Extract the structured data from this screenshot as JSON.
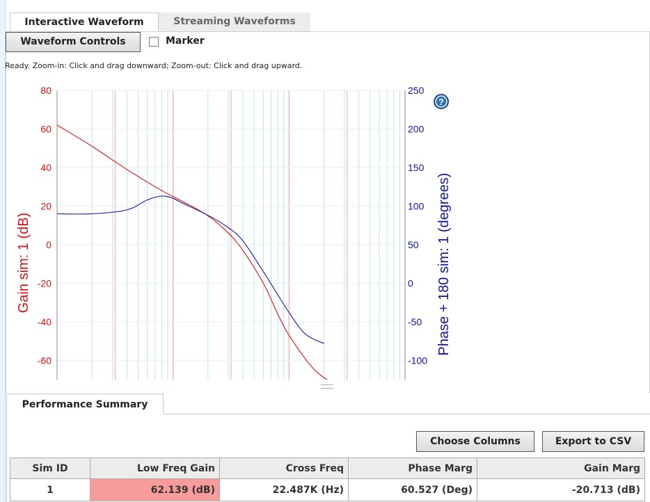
{
  "tabs": {
    "interactive": "Interactive Waveform",
    "streaming": "Streaming Waveforms"
  },
  "controls": {
    "waveform_button": "Waveform Controls",
    "marker_label": "Marker"
  },
  "status": "Ready.  Zoom-in: Click and drag downward; Zoom-out: Click and drag upward.",
  "colors": {
    "gain": "#dd1111",
    "phase": "#1111aa",
    "highlight": "#f79b9b"
  },
  "chart_data": {
    "type": "line",
    "x_scale": "log",
    "xlim": [
      1000,
      1000000
    ],
    "ylabel_left": "Gain sim:  1 (dB)",
    "ylabel_right": "Phase + 180 sim:  1 (degrees)",
    "ylim_left": [
      -70,
      80
    ],
    "ylim_right": [
      -125,
      250
    ],
    "yticks_left": [
      "80",
      "60",
      "40",
      "20",
      "0",
      "-20",
      "-40",
      "-60"
    ],
    "yticks_right": [
      "250",
      "200",
      "150",
      "100",
      "50",
      "0",
      "-50",
      "-100"
    ],
    "grid": true,
    "series": [
      {
        "name": "Gain",
        "axis": "left",
        "color": "#dd1111",
        "x": [
          1000,
          2000,
          4000,
          8000,
          12000,
          20000,
          30000,
          40000,
          60000,
          80000,
          100000,
          150000,
          200000,
          250000
        ],
        "y": [
          62,
          51,
          39,
          28,
          22.5,
          15,
          6,
          -3,
          -20,
          -36,
          -47,
          -62,
          -69,
          -72
        ]
      },
      {
        "name": "Phase",
        "axis": "right",
        "color": "#1111aa",
        "x": [
          1000,
          2000,
          4000,
          6000,
          8000,
          10000,
          12000,
          20000,
          30000,
          40000,
          60000,
          80000,
          100000,
          130000,
          160000,
          200000
        ],
        "y": [
          90,
          90,
          95,
          108,
          113,
          110,
          104,
          88,
          72,
          55,
          15,
          -15,
          -38,
          -62,
          -72,
          -78
        ]
      }
    ]
  },
  "performance": {
    "tab": "Performance Summary",
    "choose_columns": "Choose Columns",
    "export_csv": "Export to CSV",
    "columns": [
      "Sim ID",
      "Low Freq Gain",
      "Cross Freq",
      "Phase Marg",
      "Gain Marg"
    ],
    "rows": [
      [
        "1",
        "62.139 (dB)",
        "22.487K (Hz)",
        "60.527 (Deg)",
        "-20.713 (dB)"
      ]
    ]
  }
}
